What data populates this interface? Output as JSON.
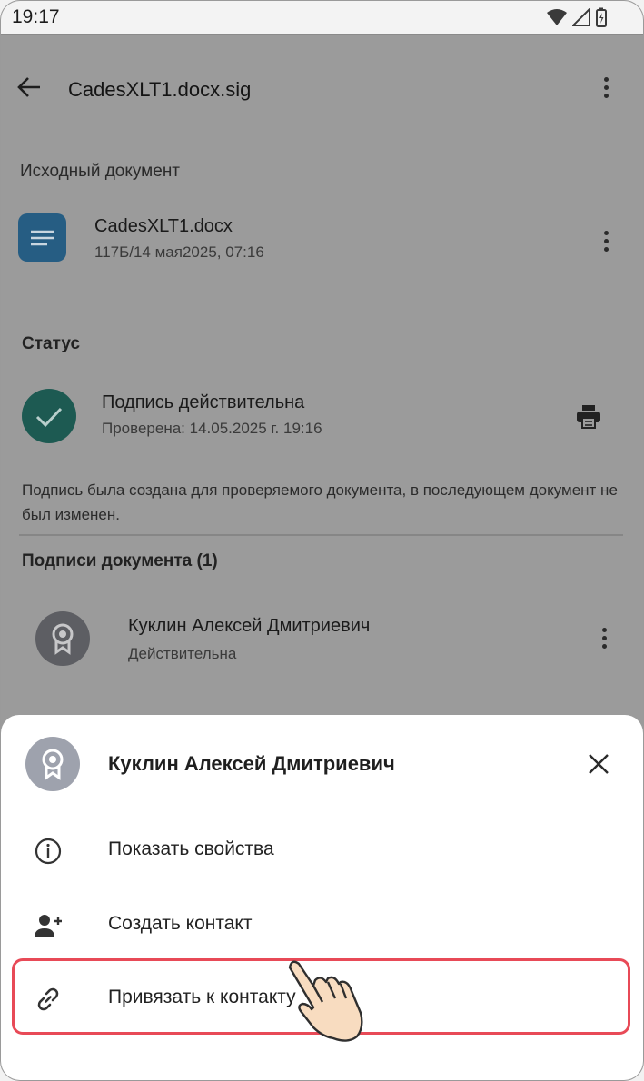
{
  "status_bar": {
    "time": "19:17"
  },
  "header": {
    "title": "CadesXLT1.docx.sig"
  },
  "source": {
    "section_label": "Исходный документ",
    "file_name": "CadesXLT1.docx",
    "file_meta": "117Б/14 мая2025, 07:16"
  },
  "status": {
    "section_label": "Статус",
    "title": "Подпись действительна",
    "checked": "Проверена: 14.05.2025 г. 19:16",
    "description": "Подпись была создана для проверяемого документа, в последующем документ не был изменен."
  },
  "signatures": {
    "section_label": "Подписи документа (1)",
    "items": [
      {
        "name": "Куклин Алексей Дмитриевич",
        "state": "Действительна"
      }
    ]
  },
  "sheet": {
    "name": "Куклин Алексей Дмитриевич",
    "actions": [
      {
        "label": "Показать свойства",
        "icon": "info-icon"
      },
      {
        "label": "Создать контакт",
        "icon": "add-person-icon"
      },
      {
        "label": "Привязать к контакту",
        "icon": "link-icon"
      }
    ]
  },
  "colors": {
    "overlay": "#9b9b9b",
    "doc_icon": "#265d83",
    "check_circle": "#1d5a52",
    "highlight": "#e84a57"
  }
}
